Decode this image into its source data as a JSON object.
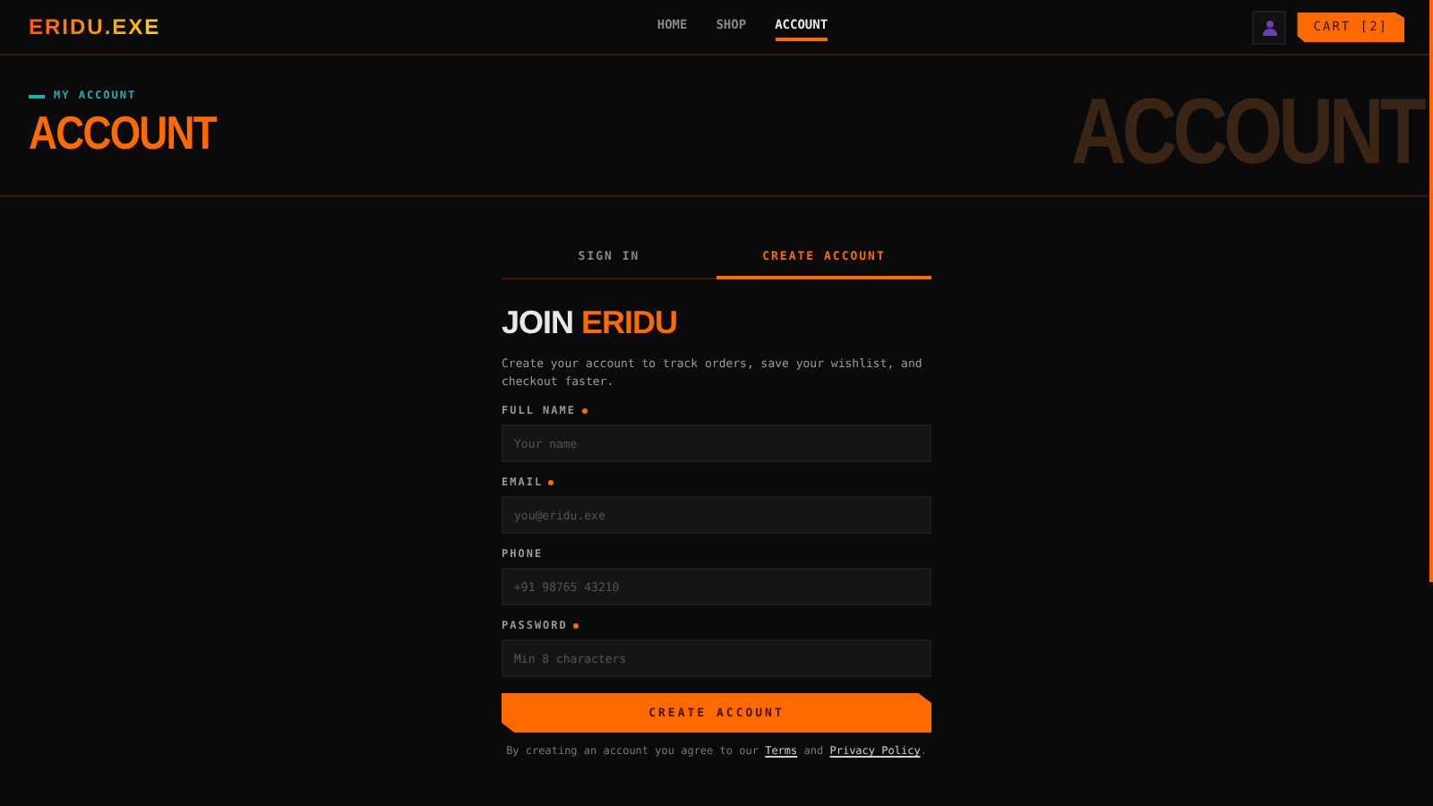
{
  "header": {
    "logo": "ERIDU.EXE",
    "nav": [
      {
        "label": "HOME",
        "selected": false
      },
      {
        "label": "SHOP",
        "selected": false
      },
      {
        "label": "ACCOUNT",
        "selected": true
      }
    ],
    "cart": "CART [2]"
  },
  "hero": {
    "eyebrow": "MY ACCOUNT",
    "title": "ACCOUNT",
    "backdrop": "ACCOUNT"
  },
  "tabs": [
    {
      "label": "SIGN IN",
      "selected": false
    },
    {
      "label": "CREATE ACCOUNT",
      "selected": true
    }
  ],
  "form": {
    "heading": "JOIN",
    "heading_accent": "ERIDU",
    "intro": "Create your account to track orders, save your wishlist, and checkout faster.",
    "fields": [
      {
        "label": "FULL NAME",
        "required": true,
        "placeholder": "Your name"
      },
      {
        "label": "EMAIL",
        "required": true,
        "placeholder": "you@eridu.exe"
      },
      {
        "label": "PHONE",
        "required": false,
        "placeholder": "+91 98765 43210"
      },
      {
        "label": "PASSWORD",
        "required": true,
        "placeholder": "Min 8 characters"
      }
    ],
    "submit": "CREATE ACCOUNT",
    "legal": {
      "text": "By creating an account you agree to our",
      "terms": "Terms",
      "joiner": "and",
      "privacy": "Privacy Policy",
      "end": "."
    }
  }
}
